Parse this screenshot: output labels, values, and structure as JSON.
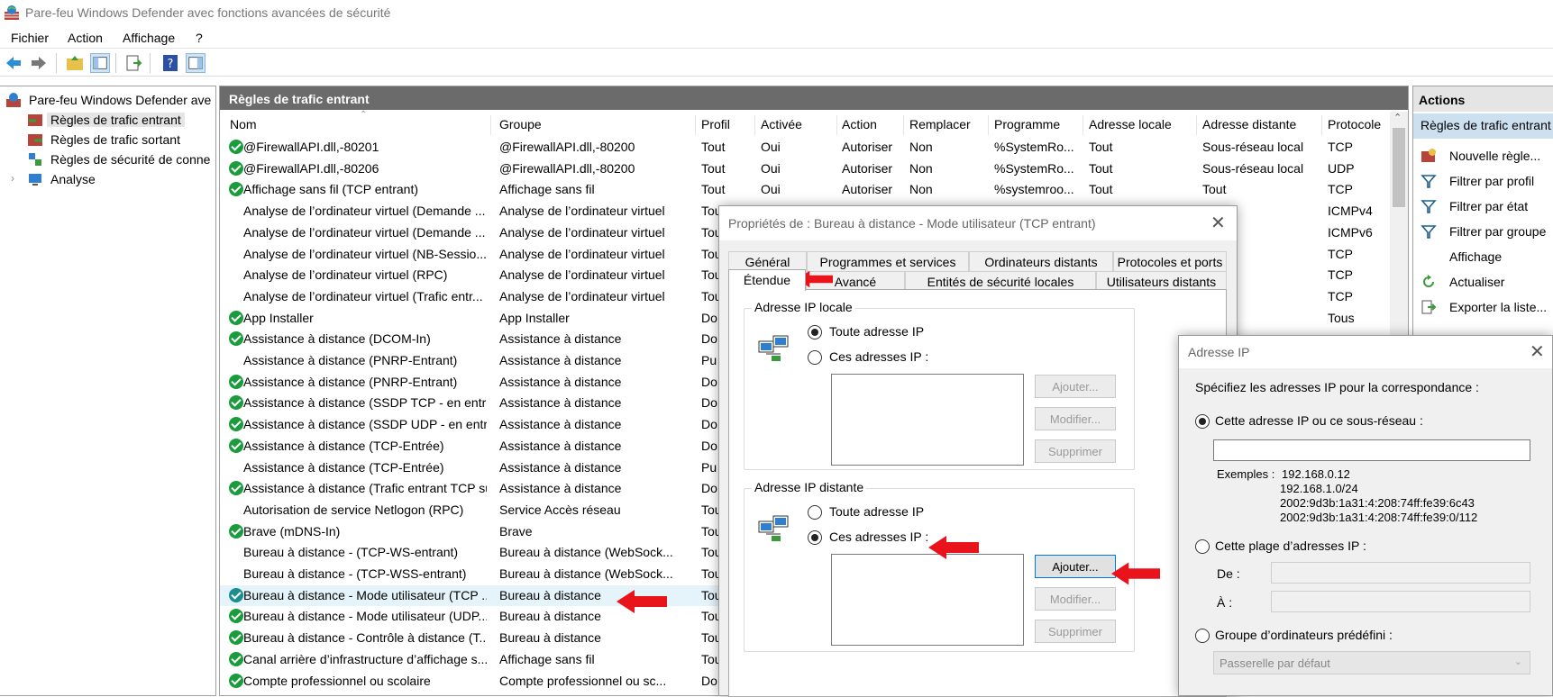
{
  "window": {
    "title": "Pare-feu Windows Defender avec fonctions avancées de sécurité"
  },
  "menu": [
    "Fichier",
    "Action",
    "Affichage",
    "?"
  ],
  "tree": {
    "root": "Pare-feu Windows Defender ave",
    "items": [
      "Règles de trafic entrant",
      "Règles de trafic sortant",
      "Règles de sécurité de conne",
      "Analyse"
    ]
  },
  "center": {
    "header": "Règles de trafic entrant",
    "columns": [
      "Nom",
      "Groupe",
      "Profil",
      "Activée",
      "Action",
      "Remplacer",
      "Programme",
      "Adresse locale",
      "Adresse distante",
      "Protocole"
    ],
    "rows": [
      {
        "c": true,
        "nom": "@FirewallAPI.dll,-80201",
        "groupe": "@FirewallAPI.dll,-80200",
        "profil": "Tout",
        "activee": "Oui",
        "action": "Autoriser",
        "rempl": "Non",
        "prog": "%SystemRo...",
        "loc": "Tout",
        "dist": "Sous-réseau local",
        "proto": "TCP"
      },
      {
        "c": true,
        "nom": "@FirewallAPI.dll,-80206",
        "groupe": "@FirewallAPI.dll,-80200",
        "profil": "Tout",
        "activee": "Oui",
        "action": "Autoriser",
        "rempl": "Non",
        "prog": "%SystemRo...",
        "loc": "Tout",
        "dist": "Sous-réseau local",
        "proto": "UDP"
      },
      {
        "c": true,
        "nom": "Affichage sans fil (TCP entrant)",
        "groupe": "Affichage sans fil",
        "profil": "Tout",
        "activee": "Oui",
        "action": "Autoriser",
        "rempl": "Non",
        "prog": "%systemroo...",
        "loc": "Tout",
        "dist": "Tout",
        "proto": "TCP"
      },
      {
        "c": false,
        "nom": "Analyse de l’ordinateur virtuel (Demande ...",
        "groupe": "Analyse de l’ordinateur virtuel",
        "profil": "Tou",
        "proto": "ICMPv4"
      },
      {
        "c": false,
        "nom": "Analyse de l’ordinateur virtuel (Demande ...",
        "groupe": "Analyse de l’ordinateur virtuel",
        "profil": "Tou",
        "proto": "ICMPv6"
      },
      {
        "c": false,
        "nom": "Analyse de l’ordinateur virtuel (NB-Sessio...",
        "groupe": "Analyse de l’ordinateur virtuel",
        "profil": "Tou",
        "proto": "TCP"
      },
      {
        "c": false,
        "nom": "Analyse de l’ordinateur virtuel (RPC)",
        "groupe": "Analyse de l’ordinateur virtuel",
        "profil": "Tou",
        "proto": "TCP"
      },
      {
        "c": false,
        "nom": "Analyse de l’ordinateur virtuel (Trafic entr...",
        "groupe": "Analyse de l’ordinateur virtuel",
        "profil": "Tou",
        "proto": "TCP"
      },
      {
        "c": true,
        "nom": "App Installer",
        "groupe": "App Installer",
        "profil": "Do",
        "proto": "Tous"
      },
      {
        "c": true,
        "nom": "Assistance à distance (DCOM-In)",
        "groupe": "Assistance à distance",
        "profil": "Do",
        "proto": ""
      },
      {
        "c": false,
        "nom": "Assistance à distance (PNRP-Entrant)",
        "groupe": "Assistance à distance",
        "profil": "Pu",
        "proto": ""
      },
      {
        "c": true,
        "nom": "Assistance à distance (PNRP-Entrant)",
        "groupe": "Assistance à distance",
        "profil": "Do",
        "proto": ""
      },
      {
        "c": true,
        "nom": "Assistance à distance (SSDP TCP - en entrée)",
        "groupe": "Assistance à distance",
        "profil": "Do",
        "proto": ""
      },
      {
        "c": true,
        "nom": "Assistance à distance (SSDP UDP - en entr...",
        "groupe": "Assistance à distance",
        "profil": "Do",
        "proto": ""
      },
      {
        "c": true,
        "nom": "Assistance à distance (TCP-Entrée)",
        "groupe": "Assistance à distance",
        "profil": "Do",
        "proto": ""
      },
      {
        "c": false,
        "nom": "Assistance à distance (TCP-Entrée)",
        "groupe": "Assistance à distance",
        "profil": "Pu",
        "proto": ""
      },
      {
        "c": true,
        "nom": "Assistance à distance (Trafic entrant TCP su...",
        "groupe": "Assistance à distance",
        "profil": "Do",
        "proto": ""
      },
      {
        "c": false,
        "nom": "Autorisation de service Netlogon (RPC)",
        "groupe": "Service Accès réseau",
        "profil": "Tou",
        "proto": ""
      },
      {
        "c": true,
        "nom": "Brave (mDNS-In)",
        "groupe": "Brave",
        "profil": "Tou",
        "proto": ""
      },
      {
        "c": false,
        "nom": "Bureau à distance - (TCP-WS-entrant)",
        "groupe": "Bureau à distance (WebSock...",
        "profil": "Tou",
        "proto": ""
      },
      {
        "c": false,
        "nom": "Bureau à distance - (TCP-WSS-entrant)",
        "groupe": "Bureau à distance (WebSock...",
        "profil": "Tou",
        "proto": ""
      },
      {
        "c": true,
        "teal": true,
        "sel": true,
        "nom": "Bureau à distance - Mode utilisateur (TCP ...",
        "groupe": "Bureau à distance",
        "profil": "Tou",
        "proto": ""
      },
      {
        "c": true,
        "nom": "Bureau à distance - Mode utilisateur (UDP...",
        "groupe": "Bureau à distance",
        "profil": "Tou",
        "proto": ""
      },
      {
        "c": true,
        "nom": "Bureau à distance - Contrôle à distance (T...",
        "groupe": "Bureau à distance",
        "profil": "Tou",
        "proto": ""
      },
      {
        "c": true,
        "nom": "Canal arrière d’infrastructure d’affichage s...",
        "groupe": "Affichage sans fil",
        "profil": "Tou",
        "proto": ""
      },
      {
        "c": true,
        "nom": "Compte professionnel ou scolaire",
        "groupe": "Compte professionnel ou sc...",
        "profil": "Do",
        "proto": ""
      }
    ]
  },
  "actions": {
    "title": "Actions",
    "subtitle": "Règles de trafic entrant",
    "items": [
      "Nouvelle règle...",
      "Filtrer par profil",
      "Filtrer par état",
      "Filtrer par groupe",
      "Affichage",
      "Actualiser",
      "Exporter la liste..."
    ]
  },
  "dialog1": {
    "title": "Propriétés de : Bureau à distance - Mode utilisateur (TCP entrant)",
    "tabs_row1": [
      "Général",
      "Programmes et services",
      "Ordinateurs distants",
      "Protocoles et ports"
    ],
    "tabs_row2": [
      "Étendue",
      "Avancé",
      "Entités de sécurité locales",
      "Utilisateurs distants"
    ],
    "local": {
      "label": "Adresse IP locale",
      "opt_any": "Toute adresse IP",
      "opt_these": "Ces adresses IP :"
    },
    "remote": {
      "label": "Adresse IP distante",
      "opt_any": "Toute adresse IP",
      "opt_these": "Ces adresses IP :"
    },
    "buttons": {
      "add": "Ajouter...",
      "edit": "Modifier...",
      "remove": "Supprimer"
    }
  },
  "dialog2": {
    "title": "Adresse IP",
    "prompt": "Spécifiez les adresses IP pour la correspondance :",
    "opt_single": "Cette adresse IP ou ce sous-réseau :",
    "examples_label": "Exemples :",
    "examples": [
      "192.168.0.12",
      "192.168.1.0/24",
      "2002:9d3b:1a31:4:208:74ff:fe39:6c43",
      "2002:9d3b:1a31:4:208:74ff:fe39:0/112"
    ],
    "opt_range": "Cette plage d’adresses IP :",
    "from_label": "De :",
    "to_label": "À :",
    "opt_group": "Groupe d’ordinateurs prédéfini :",
    "group_value": "Passerelle par défaut"
  },
  "colors": {
    "selection": "#e5f3fb",
    "header": "#6b6b6b",
    "arrow": "#e8131b",
    "check": "#1a9b3c"
  }
}
